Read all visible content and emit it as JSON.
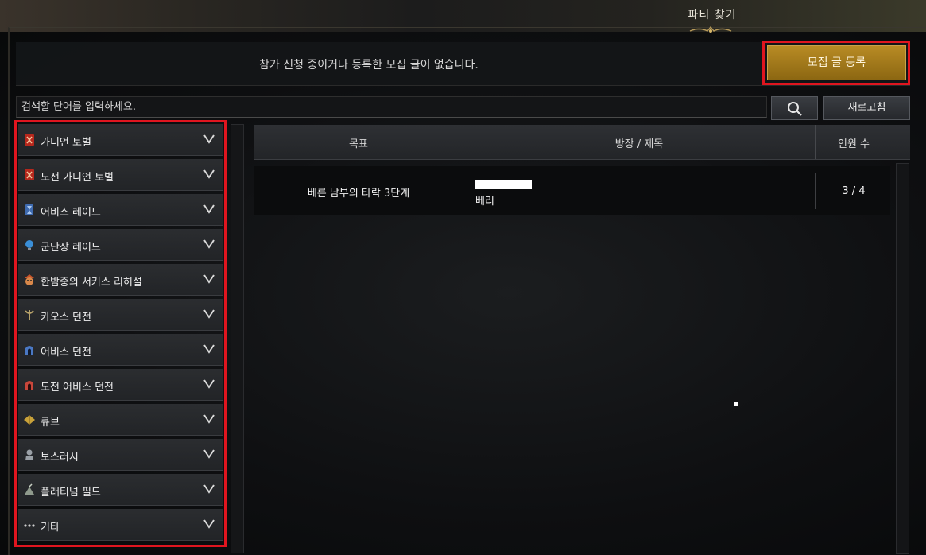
{
  "window": {
    "title": "파티 찾기"
  },
  "notice": {
    "message": "참가 신청 중이거나 등록한 모집 글이 없습니다."
  },
  "toolbar": {
    "register_label": "모집 글 등록",
    "search_placeholder": "검색할 단어를 입력하세요.",
    "refresh_label": "새로고침"
  },
  "categories": [
    {
      "label": "가디언 토벌",
      "icon": "guardian-icon",
      "color": "#b7281d"
    },
    {
      "label": "도전 가디언 토벌",
      "icon": "challenge-guardian-icon",
      "color": "#b7281d"
    },
    {
      "label": "어비스 레이드",
      "icon": "abyss-raid-icon",
      "color": "#3f6bb0"
    },
    {
      "label": "군단장 레이드",
      "icon": "legion-raid-icon",
      "color": "#3a8fd8"
    },
    {
      "label": "한밤중의 서커스 리허설",
      "icon": "circus-icon",
      "color": "#c9542a"
    },
    {
      "label": "카오스 던전",
      "icon": "chaos-dungeon-icon",
      "color": "#b8a36a"
    },
    {
      "label": "어비스 던전",
      "icon": "abyss-dungeon-icon",
      "color": "#4a78c4"
    },
    {
      "label": "도전 어비스 던전",
      "icon": "challenge-abyss-icon",
      "color": "#c8463a"
    },
    {
      "label": "큐브",
      "icon": "cube-icon",
      "color": "#c9a23a"
    },
    {
      "label": "보스러시",
      "icon": "boss-rush-icon",
      "color": "#9aa0a6"
    },
    {
      "label": "플래티넘 필드",
      "icon": "platinum-field-icon",
      "color": "#8f9a8c"
    },
    {
      "label": "기타",
      "icon": "more-icon",
      "color": "#d0d0d0"
    }
  ],
  "table": {
    "headers": {
      "goal": "목표",
      "title": "방장 / 제목",
      "members": "인원 수"
    },
    "rows": [
      {
        "goal": "베른 남부의 타락 3단계",
        "title": "베리",
        "members": "3 / 4"
      }
    ]
  },
  "colors": {
    "accent_gold": "#b88b24",
    "highlight_red": "#e0151f"
  }
}
